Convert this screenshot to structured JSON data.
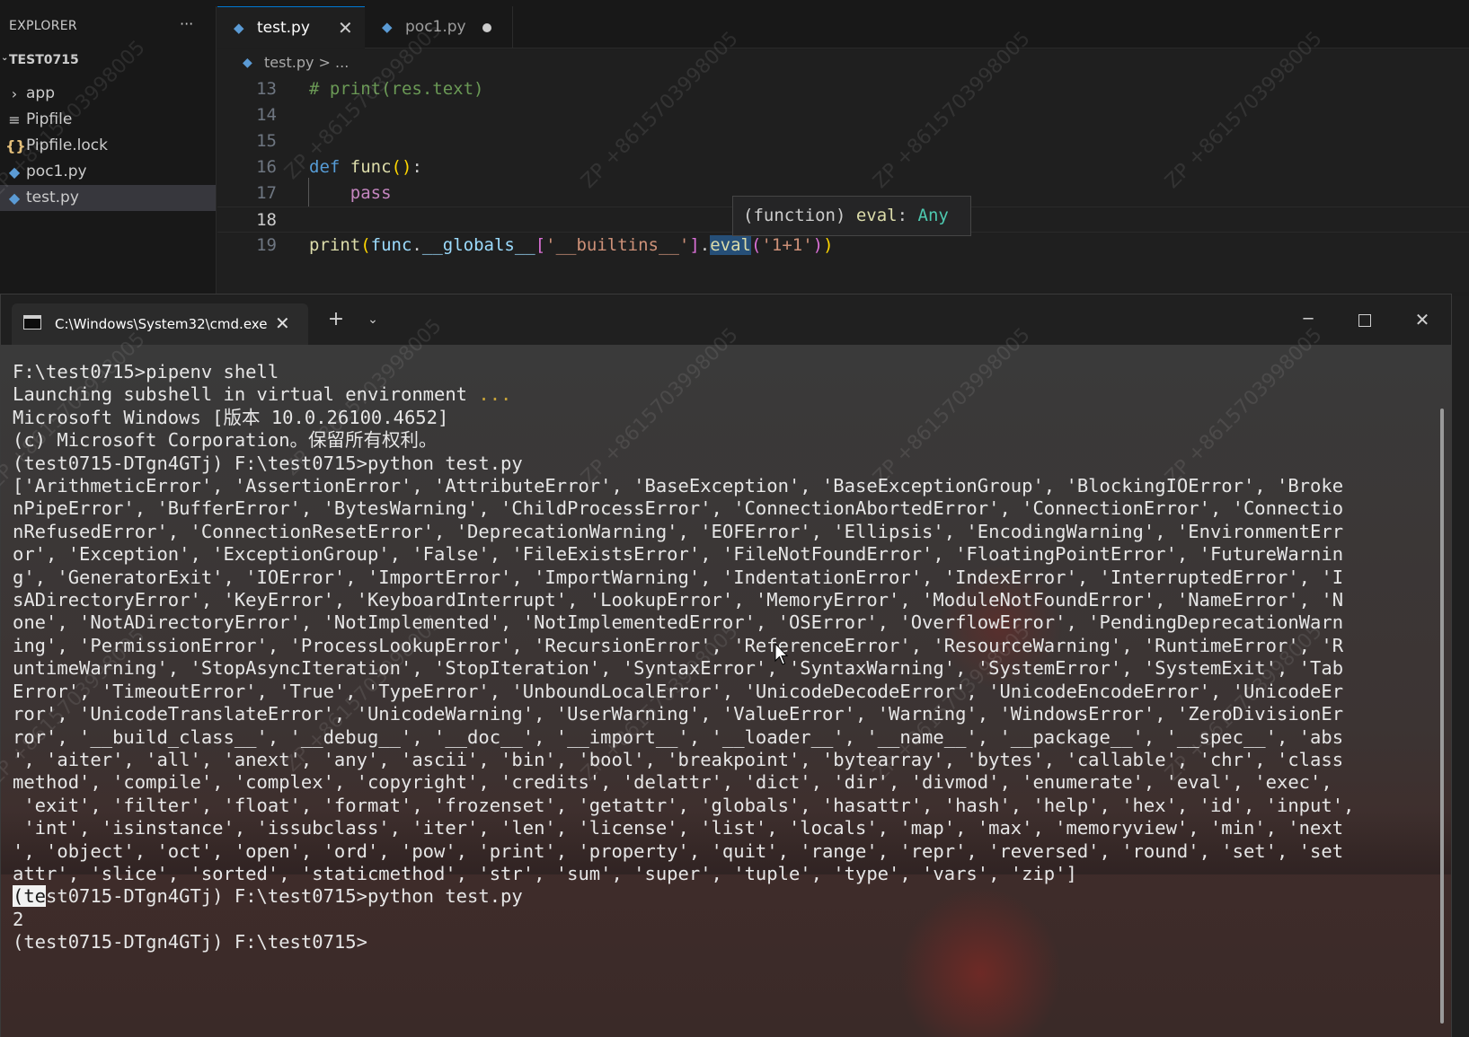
{
  "explorer": {
    "title": "EXPLORER",
    "more": "···",
    "project": "TEST0715",
    "items": [
      {
        "label": "app",
        "icon": "chevron-right-icon"
      },
      {
        "label": "Pipfile",
        "icon": "lines-file-icon"
      },
      {
        "label": "Pipfile.lock",
        "icon": "json-braces-icon"
      },
      {
        "label": "poc1.py",
        "icon": "python-file-icon"
      },
      {
        "label": "test.py",
        "icon": "python-file-icon",
        "active": true
      }
    ]
  },
  "tabs": [
    {
      "label": "test.py",
      "active": true
    },
    {
      "label": "poc1.py",
      "modified": true
    }
  ],
  "breadcrumb": {
    "file": "test.py",
    "rest": " > ..."
  },
  "editor": {
    "line_numbers": [
      "13",
      "14",
      "15",
      "16",
      "17",
      "18",
      "19"
    ],
    "current_line": "18",
    "hover": {
      "prefix": "(function) ",
      "name": "eval",
      "colon": ": ",
      "type": "Any"
    }
  },
  "terminal": {
    "tab_title": "C:\\Windows\\System32\\cmd.exe",
    "output": [
      "F:\\test0715>pipenv shell",
      "Microsoft Windows [版本 10.0.26100.4652]",
      "(c) Microsoft Corporation。保留所有权利。",
      "",
      "(test0715-DTgn4GTj) F:\\test0715>python test.py",
      "['ArithmeticError', 'AssertionError', 'AttributeError', 'BaseException', 'BaseExceptionGroup', 'BlockingIOError', 'Broke",
      "nPipeError', 'BufferError', 'BytesWarning', 'ChildProcessError', 'ConnectionAbortedError', 'ConnectionError', 'Connectio",
      "nRefusedError', 'ConnectionResetError', 'DeprecationWarning', 'EOFError', 'Ellipsis', 'EncodingWarning', 'EnvironmentErr",
      "or', 'Exception', 'ExceptionGroup', 'False', 'FileExistsError', 'FileNotFoundError', 'FloatingPointError', 'FutureWarnin",
      "g', 'GeneratorExit', 'IOError', 'ImportError', 'ImportWarning', 'IndentationError', 'IndexError', 'InterruptedError', 'I",
      "sADirectoryError', 'KeyError', 'KeyboardInterrupt', 'LookupError', 'MemoryError', 'ModuleNotFoundError', 'NameError', 'N",
      "one', 'NotADirectoryError', 'NotImplemented', 'NotImplementedError', 'OSError', 'OverflowError', 'PendingDeprecationWarn",
      "ing', 'PermissionError', 'ProcessLookupError', 'RecursionError', 'ReferenceError', 'ResourceWarning', 'RuntimeError', 'R",
      "untimeWarning', 'StopAsyncIteration', 'StopIteration', 'SyntaxError', 'SyntaxWarning', 'SystemError', 'SystemExit', 'Tab",
      "Error', 'TimeoutError', 'True', 'TypeError', 'UnboundLocalError', 'UnicodeDecodeError', 'UnicodeEncodeError', 'UnicodeEr",
      "ror', 'UnicodeTranslateError', 'UnicodeWarning', 'UserWarning', 'ValueError', 'Warning', 'WindowsError', 'ZeroDivisionEr",
      "ror', '__build_class__', '__debug__', '__doc__', '__import__', '__loader__', '__name__', '__package__', '__spec__', 'abs",
      "', 'aiter', 'all', 'anext', 'any', 'ascii', 'bin', 'bool', 'breakpoint', 'bytearray', 'bytes', 'callable', 'chr', 'class",
      "method', 'compile', 'complex', 'copyright', 'credits', 'delattr', 'dict', 'dir', 'divmod', 'enumerate', 'eval', 'exec',",
      " 'exit', 'filter', 'float', 'format', 'frozenset', 'getattr', 'globals', 'hasattr', 'hash', 'help', 'hex', 'id', 'input',",
      " 'int', 'isinstance', 'issubclass', 'iter', 'len', 'license', 'list', 'locals', 'map', 'max', 'memoryview', 'min', 'next",
      "', 'object', 'oct', 'open', 'ord', 'pow', 'print', 'property', 'quit', 'range', 'repr', 'reversed', 'round', 'set', 'set",
      "attr', 'slice', 'sorted', 'staticmethod', 'str', 'sum', 'super', 'tuple', 'type', 'vars', 'zip']",
      "",
      "st0715-DTgn4GTj) F:\\test0715>python test.py",
      "2",
      "",
      "(test0715-DTgn4GTj) F:\\test0715>"
    ],
    "launch_line": "Launching subshell in virtual environment",
    "launch_dots": "...",
    "selected_prefix": "(te"
  },
  "watermark": "ZP +8615703998005",
  "colors": {
    "editor_bg": "#1f1f1f",
    "sidebar_bg": "#181818",
    "accent": "#0078d4",
    "terminal_text": "#e6e6e6",
    "comment": "#6a9955",
    "keyword": "#569cd6",
    "function": "#dcdcaa",
    "string": "#ce9178"
  }
}
